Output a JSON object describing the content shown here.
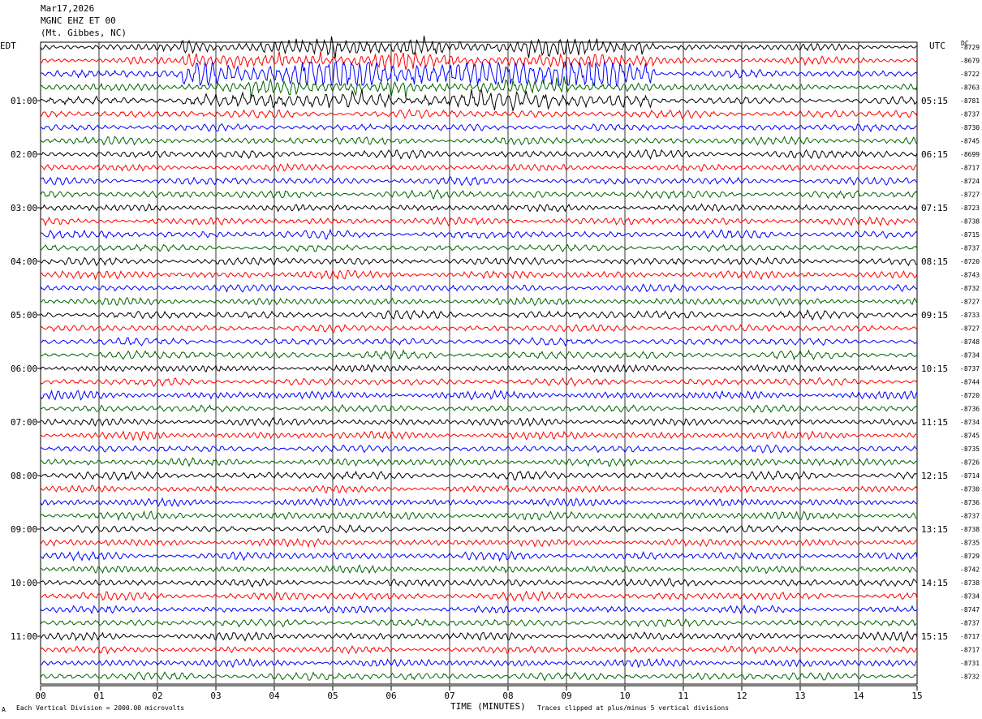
{
  "header": {
    "date": "Mar17,2026",
    "channel": "MGNC EHZ ET 00",
    "location": "(Mt. Gibbes, NC)"
  },
  "left_tz": "EDT",
  "right_tz": "UTC",
  "dc_label": "DC",
  "footer": {
    "scale_note": "Each Vertical Division = 2000.00 microvolts",
    "axis_label": "TIME (MINUTES)",
    "clip_note": "Traces clipped at plus/minus 5 vertical divisions",
    "mark": "A"
  },
  "colors": {
    "black": "#000000",
    "red": "#ff0000",
    "blue": "#0000ff",
    "green": "#006400"
  },
  "chart_data": {
    "type": "seismogram (helicorder)",
    "xlabel": "TIME (MINUTES)",
    "x_ticks": [
      "00",
      "01",
      "02",
      "03",
      "04",
      "05",
      "06",
      "07",
      "08",
      "09",
      "10",
      "11",
      "12",
      "13",
      "14",
      "15"
    ],
    "xlim": [
      0,
      15
    ],
    "line_minutes": 15,
    "trace_color_cycle": [
      "black",
      "red",
      "blue",
      "green"
    ],
    "left_hour_labels": [
      "01:00",
      "02:00",
      "03:00",
      "04:00",
      "05:00",
      "06:00",
      "07:00",
      "08:00",
      "09:00",
      "10:00",
      "11:00"
    ],
    "right_hour_labels": [
      "05:15",
      "06:15",
      "07:15",
      "08:15",
      "09:15",
      "10:15",
      "11:15",
      "12:15",
      "13:15",
      "14:15",
      "15:15"
    ],
    "dc_offsets": [
      -8729,
      -8679,
      -8722,
      -8763,
      -8781,
      -8737,
      -8730,
      -8745,
      -8699,
      -8717,
      -8724,
      -8727,
      -8723,
      -8738,
      -8715,
      -8737,
      -8720,
      -8743,
      -8732,
      -8727,
      -8733,
      -8727,
      -8748,
      -8734,
      -8737,
      -8744,
      -8720,
      -8736,
      -8734,
      -8745,
      -8735,
      -8726,
      -8714,
      -8730,
      -8736,
      -8737,
      -8738,
      -8735,
      -8729,
      -8742,
      -8738,
      -8734,
      -8747,
      -8737,
      -8717,
      -8717,
      -8731,
      -8732
    ],
    "events": [
      {
        "description": "large local signal",
        "start_trace": 0,
        "end_trace": 4,
        "start_minute": 2.4,
        "end_minute": 10.5
      }
    ]
  }
}
